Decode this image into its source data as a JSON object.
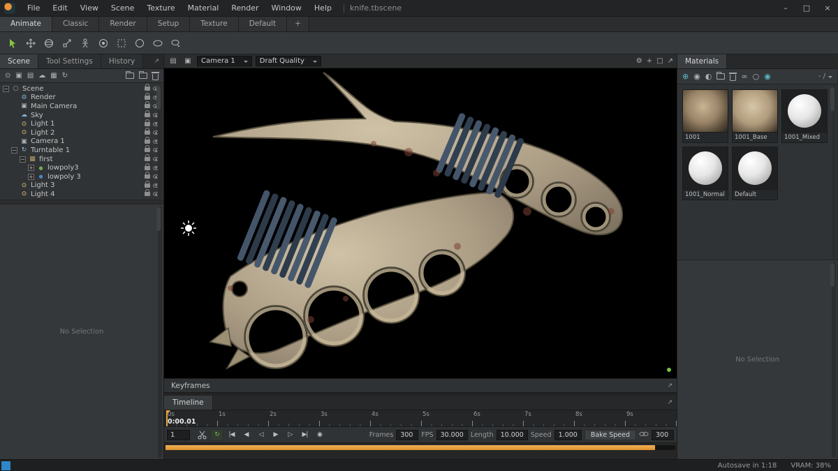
{
  "app": {
    "doc_title": "knife.tbscene"
  },
  "menubar": {
    "items": [
      "File",
      "Edit",
      "View",
      "Scene",
      "Texture",
      "Material",
      "Render",
      "Window",
      "Help"
    ]
  },
  "icons": {
    "minimize": "–",
    "maximize": "□",
    "close": "×",
    "popout": "↗",
    "gear": "⚙",
    "plus": "+",
    "screen": "▤",
    "camera": "▣",
    "bulb": "⊙",
    "rows": "▤",
    "cloud": "☁",
    "cube": "▦",
    "refresh": "↻",
    "add_circle": "⊕",
    "sphere": "◉",
    "half": "◐",
    "infinity": "∞",
    "ring": "○",
    "loop": "↻",
    "skip_start": "|◀",
    "step_back": "◀",
    "play_back": "◁",
    "play": "▶",
    "step_fwd": "▷",
    "skip_end": "▶|",
    "compass": "◉"
  },
  "layout_tabs": {
    "items": [
      "Animate",
      "Classic",
      "Render",
      "Setup",
      "Texture",
      "Default"
    ],
    "add_label": "+"
  },
  "left_panel": {
    "tabs": [
      "Scene",
      "Tool Settings",
      "History"
    ],
    "empty_text": "No Selection",
    "tree": [
      {
        "label": "Scene",
        "exp": "−"
      },
      {
        "label": "Render",
        "exp": ""
      },
      {
        "label": "Main Camera",
        "exp": ""
      },
      {
        "label": "Sky",
        "exp": ""
      },
      {
        "label": "Light 1",
        "exp": ""
      },
      {
        "label": "Light 2",
        "exp": ""
      },
      {
        "label": "Camera 1",
        "exp": ""
      },
      {
        "label": "Turntable 1",
        "exp": "−"
      },
      {
        "label": "first",
        "exp": "−"
      },
      {
        "label": "lowpoly3",
        "exp": "+"
      },
      {
        "label": "lowpoly 3",
        "exp": "+"
      },
      {
        "label": "Light 3",
        "exp": ""
      },
      {
        "label": "Light 4",
        "exp": ""
      }
    ]
  },
  "viewport": {
    "camera": "Camera 1",
    "quality": "Draft Quality"
  },
  "materials_panel": {
    "tab": "Materials",
    "counter": "- /",
    "empty_text": "No Selection",
    "items": [
      {
        "label": "1001"
      },
      {
        "label": "1001_Base"
      },
      {
        "label": "1001_Mixed"
      },
      {
        "label": "1001_Normal"
      },
      {
        "label": "Default"
      }
    ]
  },
  "timeline": {
    "keyframes_label": "Keyframes",
    "tab_label": "Timeline",
    "current_time": "0:00.01",
    "ticks": [
      "0s",
      "1s",
      "2s",
      "3s",
      "4s",
      "5s",
      "6s",
      "7s",
      "8s",
      "9s"
    ],
    "frame_field": "1",
    "fields": {
      "frames_label": "Frames",
      "frames": "300",
      "fps_label": "FPS",
      "fps": "30.000",
      "length_label": "Length",
      "length": "10.000",
      "speed_label": "Speed",
      "speed": "1.000",
      "bake_button": "Bake Speed",
      "loop_frames": "300"
    }
  },
  "statusbar": {
    "autosave": "Autosave in 1:18",
    "vram": "VRAM: 38%"
  }
}
